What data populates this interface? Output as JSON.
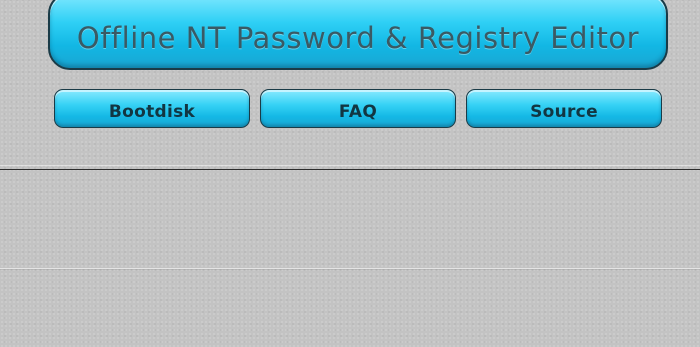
{
  "header": {
    "title": "Offline NT Password & Registry Editor"
  },
  "nav": {
    "items": [
      {
        "label": "Bootdisk"
      },
      {
        "label": "FAQ"
      },
      {
        "label": "Source"
      }
    ]
  },
  "colors": {
    "button_accent": "#1fc3ec",
    "button_border": "#1a3b47",
    "background": "#c3c3c3"
  }
}
